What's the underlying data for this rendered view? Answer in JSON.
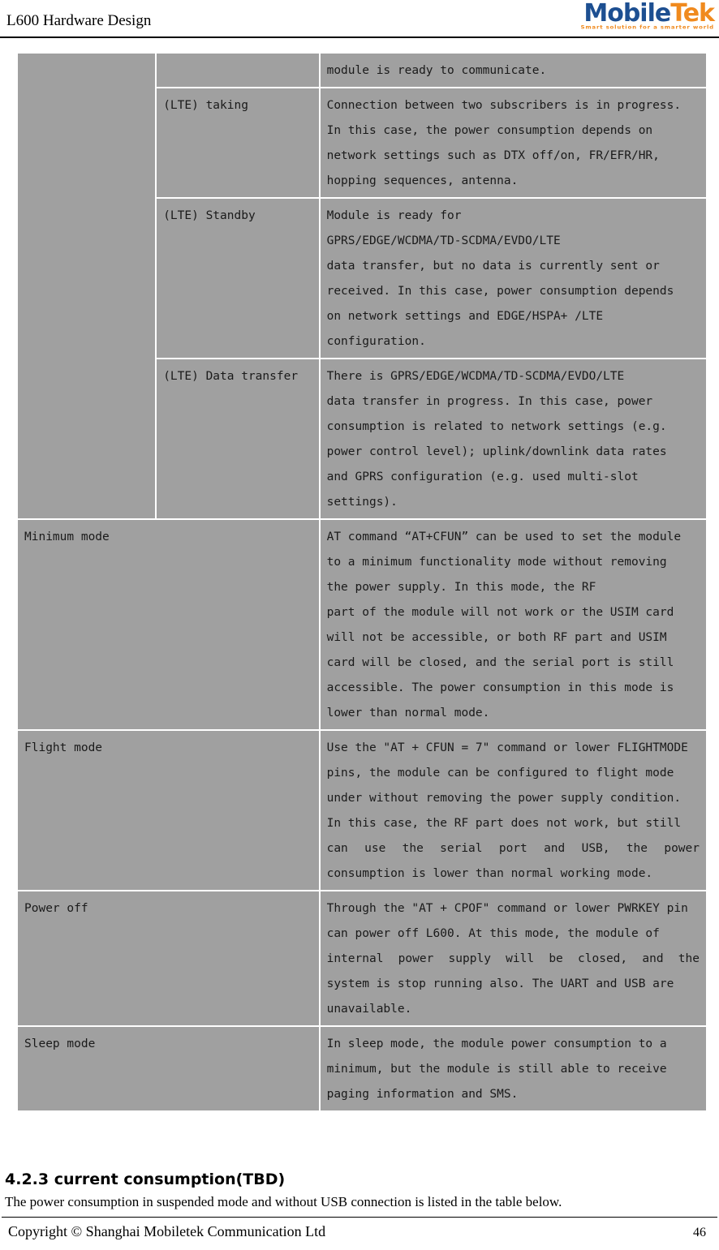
{
  "header": {
    "document_title": "L600 Hardware Design",
    "logo": {
      "word_primary": "Mobile",
      "word_secondary": "Tek",
      "tagline": "Smart solution for a smarter world",
      "color_primary": "#1d4f91",
      "color_secondary": "#f08a1e"
    }
  },
  "table": {
    "cell_background": "#a0a0a0",
    "rows": [
      {
        "mode": "",
        "substate": "",
        "description_lines": [
          "module is ready to communicate."
        ]
      },
      {
        "mode": "",
        "substate": "(LTE) taking",
        "description_lines": [
          "Connection between two subscribers is in progress.",
          "In this case, the power consumption depends on",
          "network settings such as DTX off/on, FR/EFR/HR,",
          "hopping sequences, antenna."
        ]
      },
      {
        "mode": "",
        "substate": "(LTE) Standby",
        "description_lines": [
          "Module is ready for",
          "GPRS/EDGE/WCDMA/TD-SCDMA/EVDO/LTE",
          "data transfer, but no data is currently sent or",
          "received. In this case, power consumption depends",
          "on network settings and EDGE/HSPA+ /LTE",
          "configuration."
        ]
      },
      {
        "mode": "",
        "substate": "(LTE) Data transfer",
        "description_lines": [
          "There is GPRS/EDGE/WCDMA/TD-SCDMA/EVDO/LTE",
          "data transfer in progress. In this case, power",
          "consumption is related to network settings (e.g.",
          "power control level); uplink/downlink data rates",
          "and GPRS configuration (e.g. used multi-slot",
          "settings)."
        ]
      },
      {
        "mode": "Minimum mode",
        "merged": true,
        "description_lines": [
          "AT command “AT+CFUN” can be used to set the module",
          "to a minimum functionality mode without removing",
          "the power supply. In this mode, the RF",
          "part of the module will not work or the USIM card",
          "will not be accessible, or both RF part and USIM",
          "card will be closed, and the serial port is still",
          "accessible. The power consumption in this mode is",
          "lower than normal mode."
        ]
      },
      {
        "mode": "Flight mode",
        "merged": true,
        "description_lines": [
          "Use the \"AT + CFUN = 7\" command or lower FLIGHTMODE",
          "pins, the module can be configured to flight mode",
          "under without removing the power supply condition.",
          "In this case, the RF part does not work, but still",
          "can use the serial port and USB, the power",
          "consumption is lower than normal working mode."
        ],
        "justified_line_index": 4
      },
      {
        "mode": "Power off",
        "merged": true,
        "description_lines": [
          "Through the \"AT + CPOF\" command or lower PWRKEY pin",
          "can power off L600. At this mode, the module of",
          "internal power supply will be closed, and the",
          "system is stop running also. The UART and USB are",
          "unavailable."
        ],
        "justified_line_index": 2
      },
      {
        "mode": "Sleep mode",
        "merged": true,
        "description_lines": [
          "In sleep mode, the module power consumption to a",
          "minimum, but the module is still able to receive",
          "paging information and SMS."
        ]
      }
    ]
  },
  "section": {
    "heading": "4.2.3 current consumption(TBD)",
    "paragraph": "The power consumption in suspended mode and without USB connection is listed in the table below."
  },
  "footer": {
    "copyright": "Copyright ©  Shanghai  Mobiletek  Communication  Ltd",
    "page_number": "46"
  }
}
